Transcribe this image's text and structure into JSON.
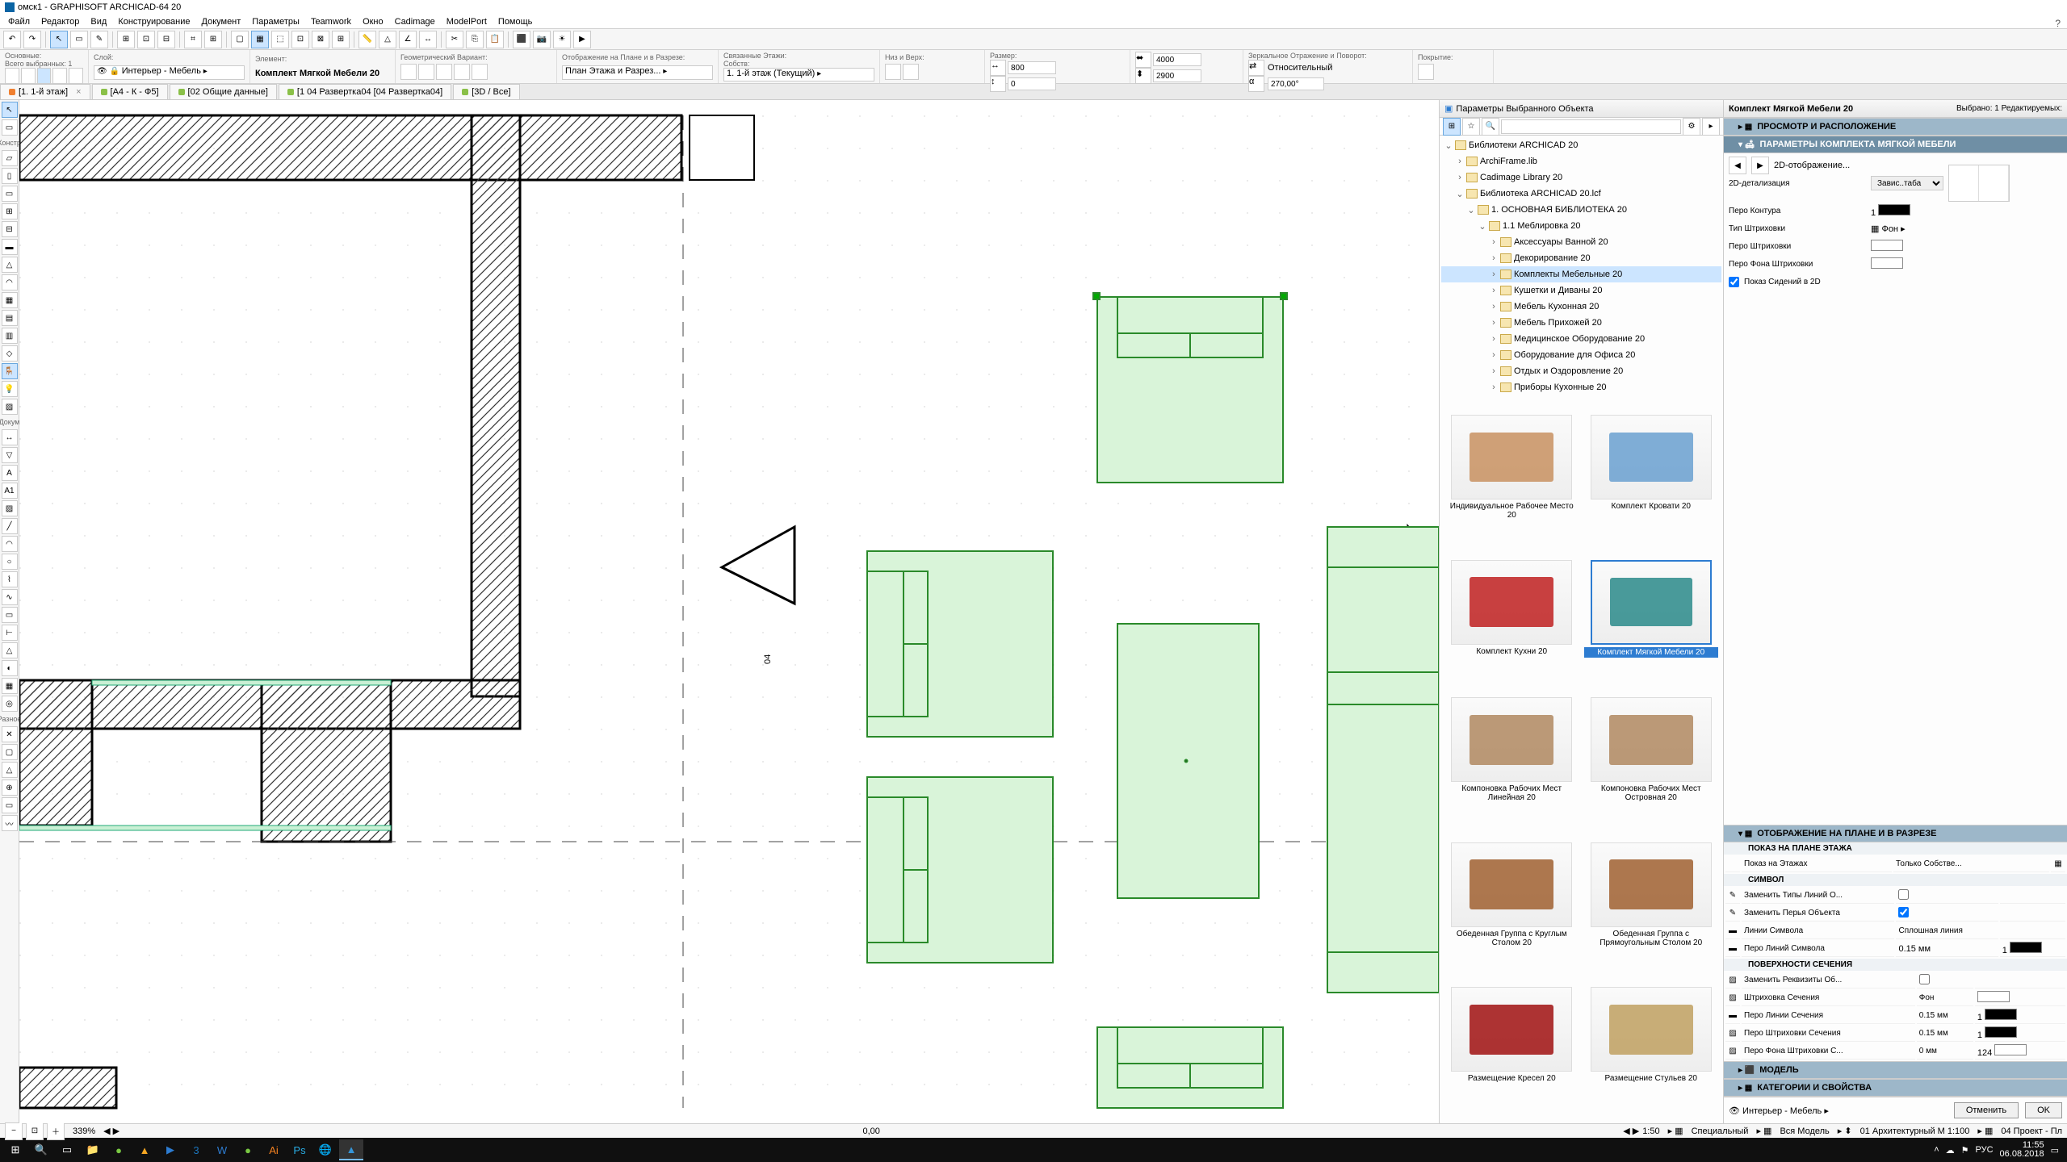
{
  "title": "омск1 - GRAPHISOFT ARCHICAD-64 20",
  "menu": [
    "Файл",
    "Редактор",
    "Вид",
    "Конструирование",
    "Документ",
    "Параметры",
    "Teamwork",
    "Окно",
    "Cadimage",
    "ModelPort",
    "Помощь"
  ],
  "info": {
    "main_label": "Основные:",
    "sel_label": "Всего выбранных: 1",
    "layer_label": "Слой:",
    "layer_value": "Интерьер - Мебель",
    "element_label": "Элемент:",
    "element_value": "Комплект Мягкой Мебели 20",
    "geo_label": "Геометрический Вариант:",
    "plan_label": "Отображение на Плане и в Разрезе:",
    "plan_value": "План Этажа и Разрез...",
    "linked_label": "Связанные Этажи:",
    "own_label": "Собств:",
    "own_value": "1. 1-й этаж (Текущий)",
    "top_bottom_label": "Низ и Верх:",
    "size_label": "Размер:",
    "size_w": "800",
    "size_h": "0",
    "size2_w": "4000",
    "size2_h": "2900",
    "mirror_label": "Зеркальное Отражение и Поворот:",
    "mirror_mode": "Относительный",
    "angle": "270,00°",
    "cover_label": "Покрытие:"
  },
  "tabs": [
    {
      "label": "[1. 1-й этаж]",
      "color": "#f08030",
      "closable": true
    },
    {
      "label": "[А4 - К - Ф5]",
      "color": "#8ac048"
    },
    {
      "label": "[02 Общие данные]",
      "color": "#8ac048"
    },
    {
      "label": "[1 04 Развертка04 [04 Развертка04]",
      "color": "#8ac048"
    },
    {
      "label": "[3D / Все]",
      "color": "#8ac048"
    }
  ],
  "left_sections": [
    "Констр",
    "Докум",
    "Разное"
  ],
  "lib": {
    "title": "Параметры Выбранного Объекта",
    "search_placeholder": "",
    "tree": [
      {
        "indent": 0,
        "open": true,
        "label": "Библиотеки ARCHICAD 20"
      },
      {
        "indent": 1,
        "open": false,
        "label": "ArchiFrame.lib"
      },
      {
        "indent": 1,
        "open": false,
        "label": "Cadimage Library 20"
      },
      {
        "indent": 1,
        "open": true,
        "label": "Библиотека ARCHICAD 20.lcf"
      },
      {
        "indent": 2,
        "open": true,
        "label": "1. ОСНОВНАЯ БИБЛИОТЕКА 20"
      },
      {
        "indent": 3,
        "open": true,
        "label": "1.1 Меблировка 20"
      },
      {
        "indent": 4,
        "open": false,
        "label": "Аксессуары Ванной 20"
      },
      {
        "indent": 4,
        "open": false,
        "label": "Декорирование 20"
      },
      {
        "indent": 4,
        "open": false,
        "label": "Комплекты Мебельные 20",
        "sel": true
      },
      {
        "indent": 4,
        "open": false,
        "label": "Кушетки и Диваны 20"
      },
      {
        "indent": 4,
        "open": false,
        "label": "Мебель Кухонная 20"
      },
      {
        "indent": 4,
        "open": false,
        "label": "Мебель Прихожей 20"
      },
      {
        "indent": 4,
        "open": false,
        "label": "Медицинское Оборудование 20"
      },
      {
        "indent": 4,
        "open": false,
        "label": "Оборудование для Офиса 20"
      },
      {
        "indent": 4,
        "open": false,
        "label": "Отдых и Оздоровление 20"
      },
      {
        "indent": 4,
        "open": false,
        "label": "Приборы Кухонные 20"
      }
    ],
    "thumbs": [
      {
        "label": "Индивидуальное Рабочее Место 20"
      },
      {
        "label": "Комплект Кровати 20"
      },
      {
        "label": "Комплект Кухни 20"
      },
      {
        "label": "Комплект Мягкой Мебели 20",
        "sel": true
      },
      {
        "label": "Компоновка Рабочих Мест Линейная 20"
      },
      {
        "label": "Компоновка Рабочих Мест Островная 20"
      },
      {
        "label": "Обеденная Группа с Круглым Столом 20"
      },
      {
        "label": "Обеденная Группа с Прямоугольным Столом 20"
      },
      {
        "label": "Размещение Кресел 20"
      },
      {
        "label": "Размещение Стульев 20"
      }
    ]
  },
  "param": {
    "title": "Комплект Мягкой Мебели 20",
    "sel_info": "Выбрано: 1 Редактируемых:",
    "sec1": "ПРОСМОТР И РАСПОЛОЖЕНИЕ",
    "sec2": "ПАРАМЕТРЫ КОМПЛЕКТА МЯГКОЙ МЕБЕЛИ",
    "nav_label": "2D-отображение...",
    "detail_label": "2D-детализация",
    "detail_value": "Завис..таба",
    "pen_contour": "Перо Контура",
    "fill_type": "Тип Штриховки",
    "fill_value": "Фон",
    "fill_pen": "Перо Штриховки",
    "fill_bg_pen": "Перо Фона Штриховки",
    "show_seats": "Показ Сидений в 2D",
    "sec3": "ОТОБРАЖЕНИЕ НА ПЛАНЕ И В РАЗРЕЗЕ",
    "sub_plan": "ПОКАЗ НА ПЛАНЕ ЭТАЖА",
    "plan_show_label": "Показ на Этажах",
    "plan_show_value": "Только Собстве...",
    "sub_symbol": "СИМВОЛ",
    "sym_replace_lines": "Заменить Типы Линий О...",
    "sym_replace_pens": "Заменить Перья Объекта",
    "sym_lines": "Линии Символа",
    "sym_lines_val": "Сплошная линия",
    "sym_pen": "Перо Линий Символа",
    "sym_pen_val": "0.15 мм",
    "sym_pen_num": "1",
    "sub_surf": "ПОВЕРХНОСТИ СЕЧЕНИЯ",
    "surf_replace": "Заменить Реквизиты Об...",
    "surf_fill": "Штриховка Сечения",
    "surf_fill_val": "Фон",
    "surf_pen": "Перо Линии Сечения",
    "surf_pen_val": "0.15 мм",
    "surf_pen_num": "1",
    "surf_fillpen": "Перо Штриховки Сечения",
    "surf_fillpen_val": "0.15 мм",
    "surf_fillpen_num": "1",
    "surf_bgpen": "Перо Фона Штриховки С...",
    "surf_bgpen_val": "0 мм",
    "surf_bgpen_num": "124",
    "sec4": "МОДЕЛЬ",
    "sec5": "КАТЕГОРИИ И СВОЙСТВА",
    "footer_layer": "Интерьер - Мебель",
    "cancel": "Отменить",
    "ok": "OK"
  },
  "status": {
    "zoom": "339%",
    "coord": "0,00",
    "scale": "1:50",
    "mode": "Специальный",
    "model": "Вся Модель",
    "arch": "01 Архитектурный М 1:100",
    "proj": "04 Проект - Пл"
  },
  "tray": {
    "lang": "РУС",
    "time": "11:55",
    "date": "06.08.2018"
  }
}
